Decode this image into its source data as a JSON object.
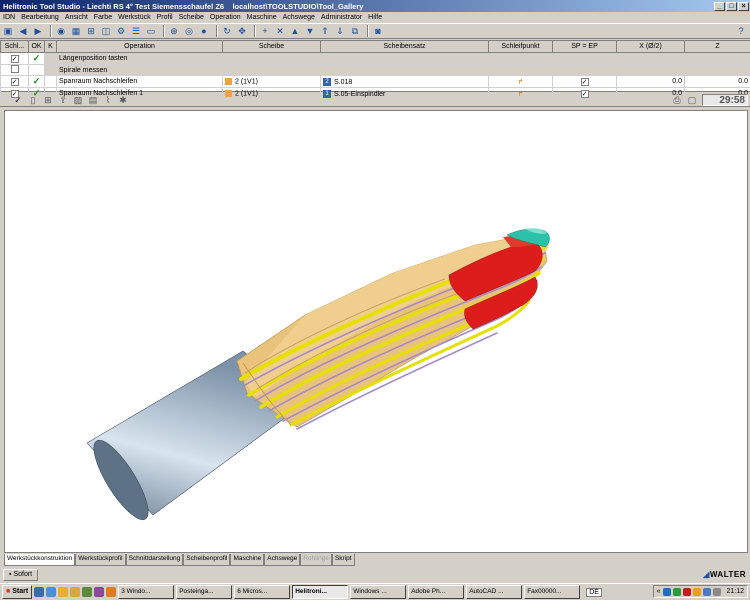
{
  "window": {
    "title": "Helitronic Tool Studio - Liechti RS 4° Test Siemensschaufel Z6",
    "path": "localhost\\TOOLSTUDIO\\Tool_Gallery"
  },
  "menu": [
    "IDN",
    "Bearbeitung",
    "Ansicht",
    "Farbe",
    "Werkstück",
    "Profil",
    "Scheibe",
    "Operation",
    "Maschine",
    "Achswege",
    "Administrator",
    "Hilfe"
  ],
  "table": {
    "headers": [
      "Schl...",
      "OK",
      "K",
      "Operation",
      "Scheibe",
      "Scheibensatz",
      "Schleifpunkt",
      "SP = EP",
      "X (Ø/2)",
      "Z"
    ],
    "rows": [
      {
        "operation": "Längenposition tasten",
        "scheibe": "",
        "satz": "",
        "x": "",
        "z": ""
      },
      {
        "operation": "Spirale messen",
        "scheibe": "",
        "satz": "",
        "x": "",
        "z": ""
      },
      {
        "operation": "Spanraum Nachschleifen",
        "scheibe": "2 (1V1)",
        "satz": "S.018",
        "x": "0.0",
        "z": "0.0"
      },
      {
        "operation": "Spanraum Nachschleifen 1",
        "scheibe": "2 (1V1)",
        "satz": "S.05-Einspindler",
        "x": "0.0",
        "z": "0.0"
      }
    ]
  },
  "timer": "29:58",
  "tabs": [
    "Werkstückkonstruktion",
    "Werkstückprofil",
    "Schnittdarstellung",
    "Scheibenprofil",
    "Maschine",
    "Achswege",
    "Rohlinge",
    "Skript"
  ],
  "status": {
    "button": "Sofort",
    "logo": "WALTER"
  },
  "taskbar": {
    "start": "Start",
    "tasks": [
      "3 Windo...",
      "Posteinga...",
      "6 Micros...",
      "Helitroni...",
      "Windows ...",
      "Adobe Ph...",
      "AutoCAD ...",
      "Fax00000..."
    ],
    "lang": "DE",
    "clock": "21:12"
  },
  "colors": {
    "titlebar": "#0a246a",
    "shank": "#9fb4c8",
    "flute": "#e9c27c",
    "edge_yellow": "#e6e000",
    "edge_purple": "#a58bc8",
    "edge_red": "#dd1c1c",
    "tip": "#2cc2aa"
  }
}
